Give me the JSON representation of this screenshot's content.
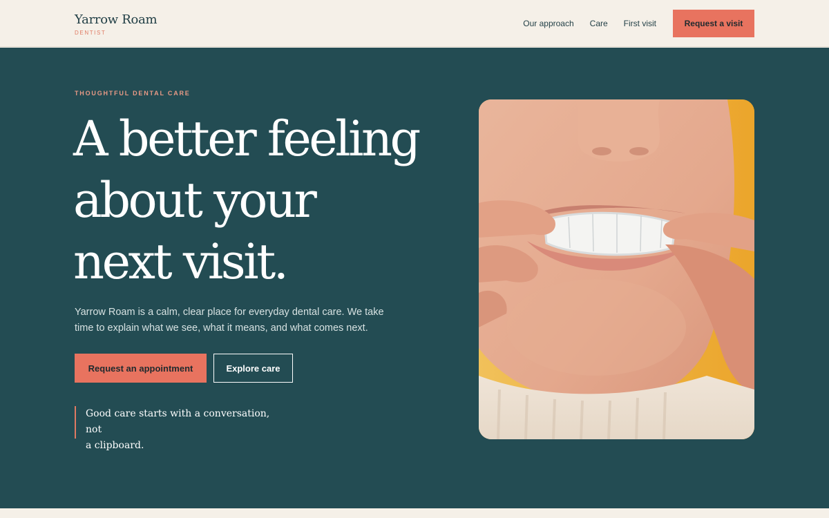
{
  "header": {
    "brand_name": "Yarrow Roam",
    "brand_sub": "DENTIST",
    "nav": [
      {
        "label": "Our approach"
      },
      {
        "label": "Care"
      },
      {
        "label": "First visit"
      }
    ],
    "cta_label": "Request a visit"
  },
  "hero": {
    "eyebrow": "THOUGHTFUL DENTAL CARE",
    "headline_lines": [
      "A better feeling",
      "about your",
      "next visit."
    ],
    "lede": "Yarrow Roam is a calm, clear place for everyday dental care. We take time to explain what we see, what it means, and what comes next.",
    "primary_button": "Request an appointment",
    "secondary_button": "Explore care",
    "quote_lines": [
      "Good care starts with a conversation, not",
      "a clipboard."
    ]
  },
  "colors": {
    "hero_bg": "#234c53",
    "accent": "#e8735f",
    "page_bg": "#f5f0e8"
  }
}
